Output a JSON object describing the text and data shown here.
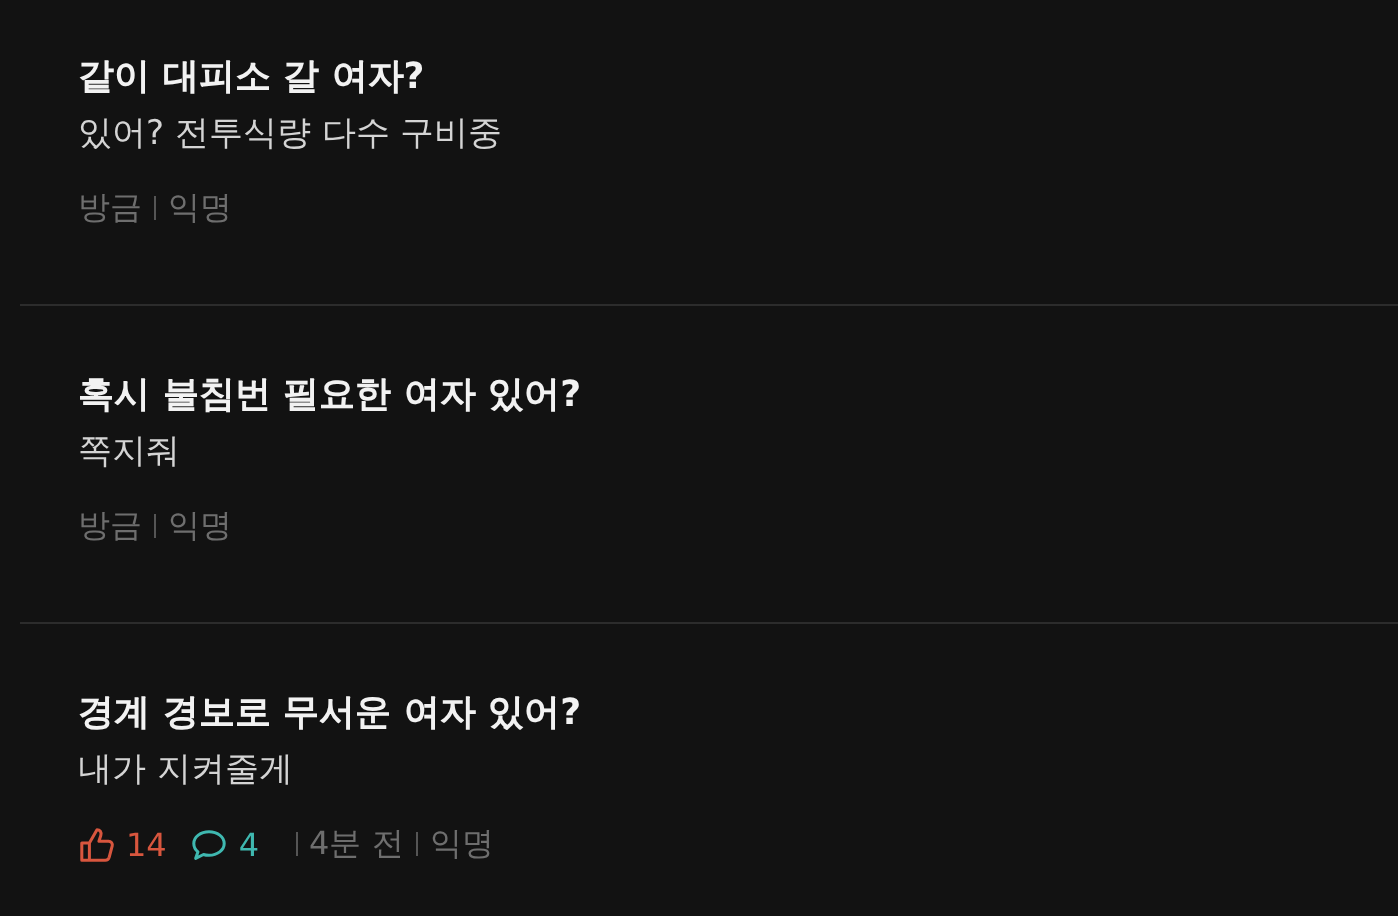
{
  "posts": [
    {
      "title": "같이 대피소 갈 여자?",
      "body": "있어? 전투식량 다수 구비중",
      "time": "방금",
      "author": "익명"
    },
    {
      "title": "혹시 불침번 필요한 여자 있어?",
      "body": "쪽지줘",
      "time": "방금",
      "author": "익명"
    },
    {
      "title": "경계 경보로 무서운 여자 있어?",
      "body": "내가 지켜줄게",
      "likes": "14",
      "comments": "4",
      "time": "4분 전",
      "author": "익명"
    }
  ]
}
